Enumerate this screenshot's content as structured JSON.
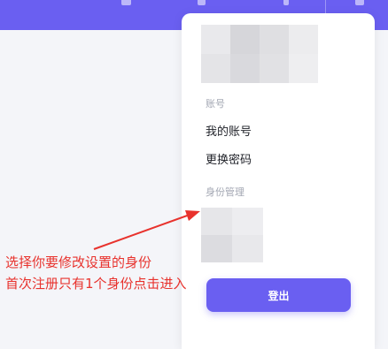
{
  "colors": {
    "accent": "#6a5ff1",
    "annotation": "#e8322d"
  },
  "account_menu": {
    "account_section_title": "账号",
    "my_account": "我的账号",
    "change_password": "更换密码",
    "identity_section_title": "身份管理",
    "logout_label": "登出"
  },
  "annotation": {
    "line1": "选择你要修改设置的身份",
    "line2": "首次注册只有1个身份点击进入"
  }
}
